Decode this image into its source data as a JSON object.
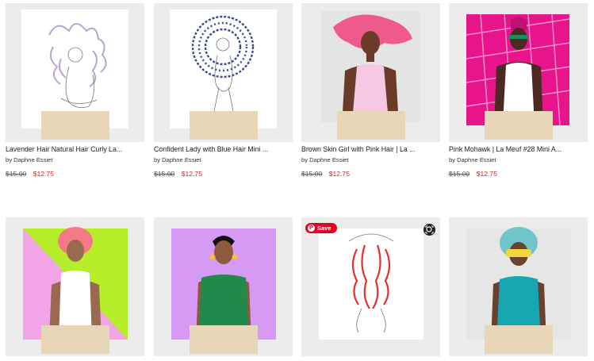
{
  "save_label": "Save",
  "products": [
    {
      "title": "Lavender Hair Natural Hair Curly La...",
      "byline": "by Daphne Essiet",
      "old_price": "$15.00",
      "new_price": "$12.75"
    },
    {
      "title": "Confident Lady with Blue Hair Mini ...",
      "byline": "by Daphne Essiet",
      "old_price": "$15.00",
      "new_price": "$12.75"
    },
    {
      "title": "Brown Skin Girl with Pink Hair | La ...",
      "byline": "by Daphne Essiet",
      "old_price": "$15.00",
      "new_price": "$12.75"
    },
    {
      "title": "Pink Mohawk | La Meuf #28 Mini A...",
      "byline": "by Daphne Essiet",
      "old_price": "$15.00",
      "new_price": "$12.75"
    },
    {
      "title": "",
      "byline": "",
      "old_price": "",
      "new_price": ""
    },
    {
      "title": "",
      "byline": "",
      "old_price": "",
      "new_price": ""
    },
    {
      "title": "",
      "byline": "",
      "old_price": "",
      "new_price": ""
    },
    {
      "title": "",
      "byline": "",
      "old_price": "",
      "new_price": ""
    }
  ]
}
